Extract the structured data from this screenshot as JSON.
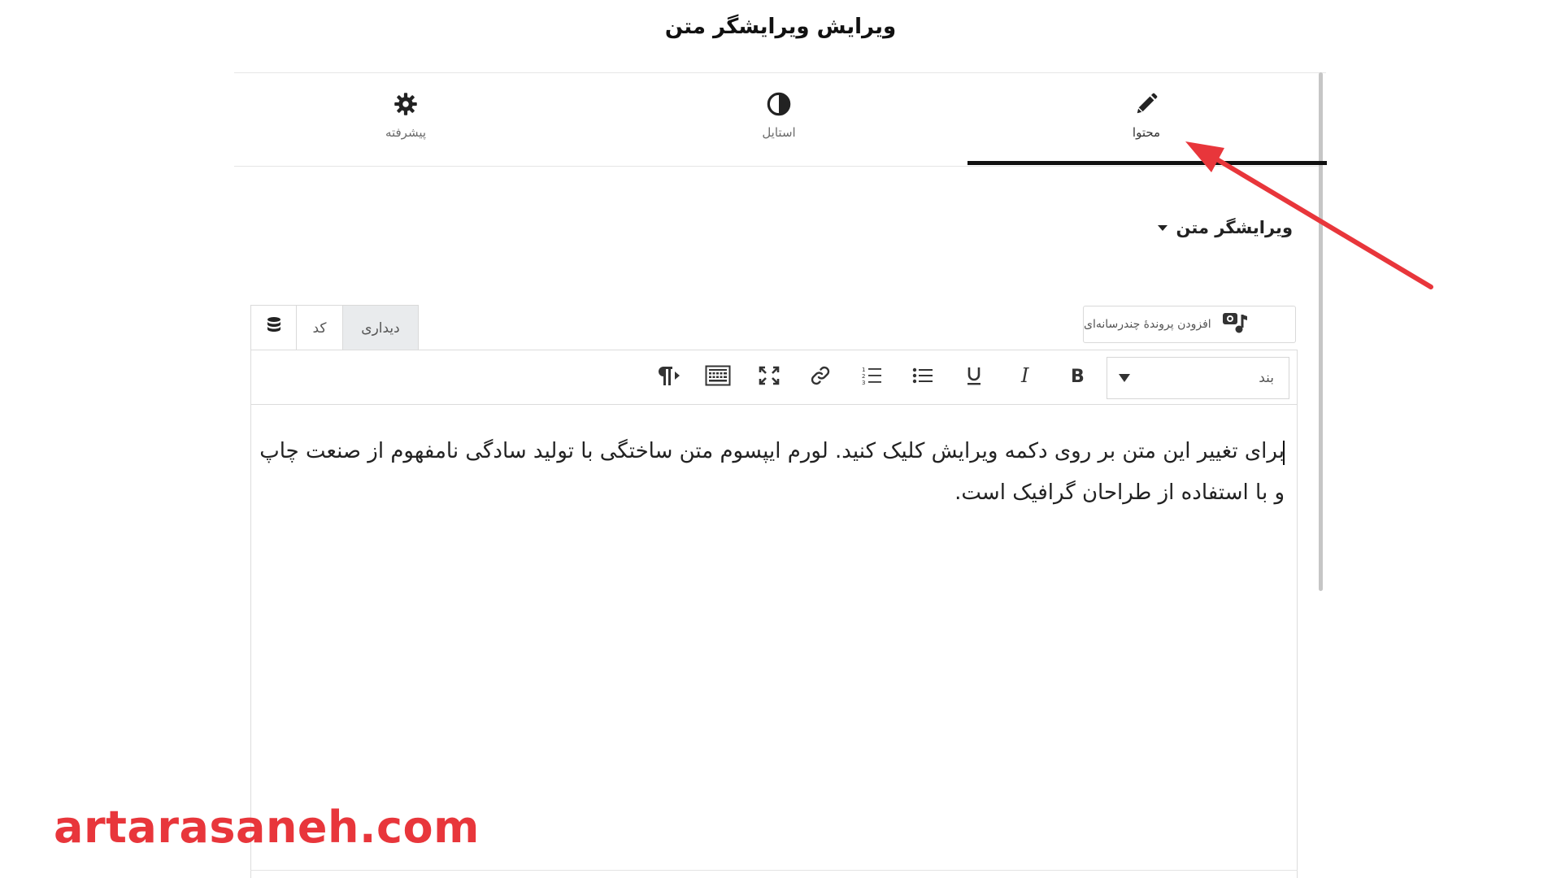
{
  "page": {
    "title": "ویرایش ویرایشگر متن"
  },
  "tabs": [
    {
      "label": "محتوا",
      "icon": "pencil-icon",
      "active": true
    },
    {
      "label": "استایل",
      "icon": "half-circle-icon",
      "active": false
    },
    {
      "label": "پیشرفته",
      "icon": "gear-icon",
      "active": false
    }
  ],
  "section": {
    "title": "ویرایشگر متن"
  },
  "editor": {
    "media_button": "افزودن پروندهٔ چندرسانه‌ای",
    "modes": {
      "visual": "دیداری",
      "code": "کد"
    },
    "format_select": "بند",
    "toolbar": [
      "bold-icon",
      "italic-icon",
      "underline-icon",
      "bullet-list-icon",
      "numbered-list-icon",
      "link-icon",
      "fullscreen-icon",
      "keyboard-icon",
      "paragraph-rtl-icon"
    ],
    "content": "برای تغییر این متن بر روی دکمه ویرایش کلیک کنید. لورم ایپسوم متن ساختگی با تولید سادگی نامفهوم از صنعت چاپ و با استفاده از طراحان گرافیک است."
  },
  "watermark": "artarasaneh.com",
  "colors": {
    "annotation_arrow": "#e8363b",
    "watermark": "#e8363b",
    "active_tab_underline": "#111111"
  }
}
